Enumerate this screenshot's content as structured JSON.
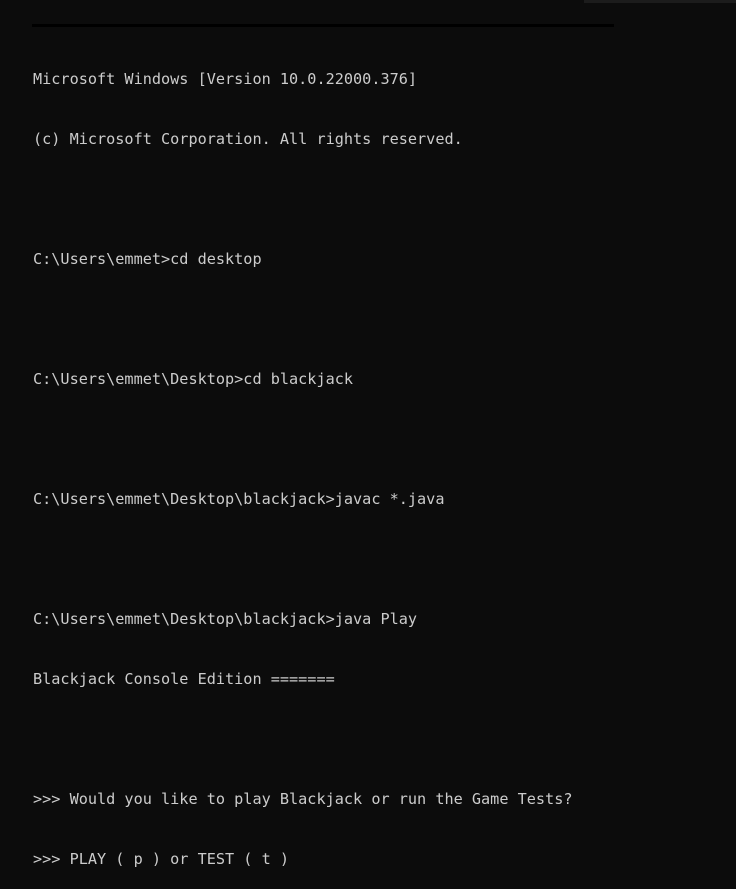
{
  "console": {
    "lines": [
      "Microsoft Windows [Version 10.0.22000.376]",
      "(c) Microsoft Corporation. All rights reserved.",
      "",
      "C:\\Users\\emmet>cd desktop",
      "",
      "C:\\Users\\emmet\\Desktop>cd blackjack",
      "",
      "C:\\Users\\emmet\\Desktop\\blackjack>javac *.java",
      "",
      "C:\\Users\\emmet\\Desktop\\blackjack>java Play",
      "Blackjack Console Edition =======",
      "",
      ">>> Would you like to play Blackjack or run the Game Tests?",
      ">>> PLAY ( p ) or TEST ( t )"
    ]
  },
  "colors": {
    "background": "#0c0c0c",
    "text": "#cccccc"
  }
}
